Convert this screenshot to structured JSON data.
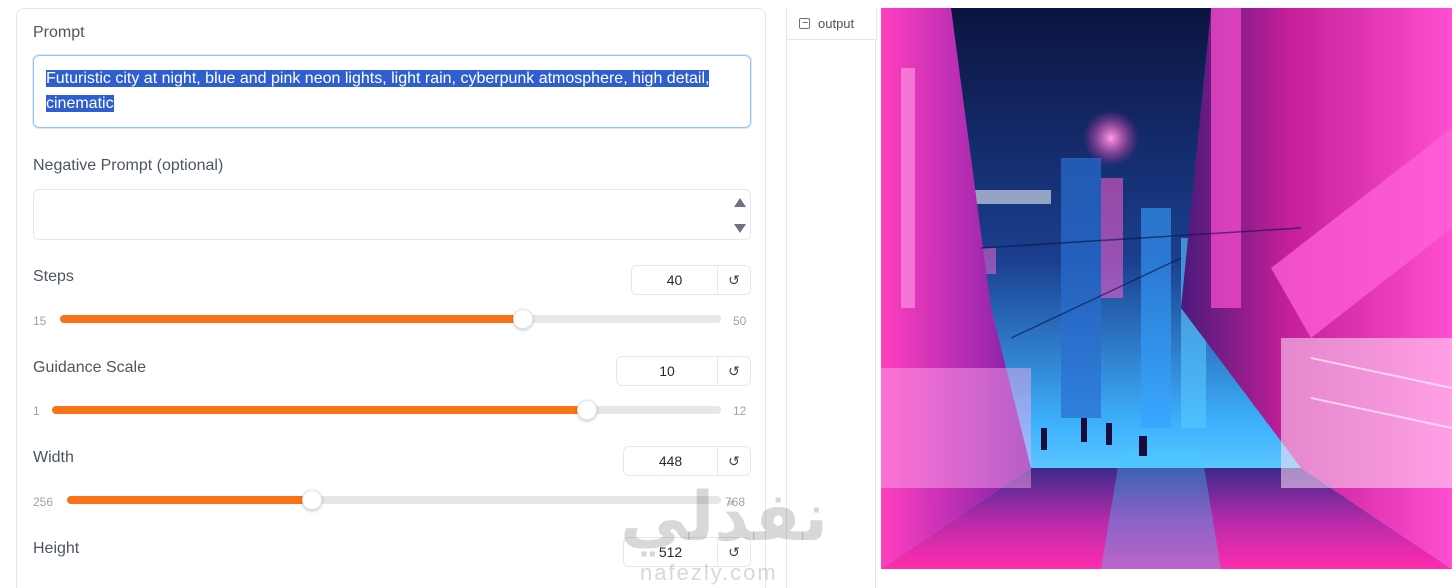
{
  "form": {
    "prompt": {
      "label": "Prompt",
      "value_line1": "Futuristic city at night, blue and pink neon lights, light rain, cyberpunk atmosphere, high detail,",
      "value_line2": "cinematic"
    },
    "negative_prompt": {
      "label": "Negative Prompt (optional)",
      "value": ""
    },
    "sliders": [
      {
        "label": "Steps",
        "value": "40",
        "min": "15",
        "max": "50",
        "fraction": 0.7
      },
      {
        "label": "Guidance Scale",
        "value": "10",
        "min": "1",
        "max": "12",
        "fraction": 0.8
      },
      {
        "label": "Width",
        "value": "448",
        "min": "256",
        "max": "768",
        "fraction": 0.375
      },
      {
        "label": "Height",
        "value": "512"
      }
    ],
    "reset_icon": "↺"
  },
  "output": {
    "tab_label": "output",
    "tab_icon": "image-icon"
  },
  "watermark": {
    "arabic": "نفذلي",
    "latin": "nafezly.com"
  },
  "colors": {
    "accent": "#f97316",
    "selection": "#2f5fcf"
  }
}
